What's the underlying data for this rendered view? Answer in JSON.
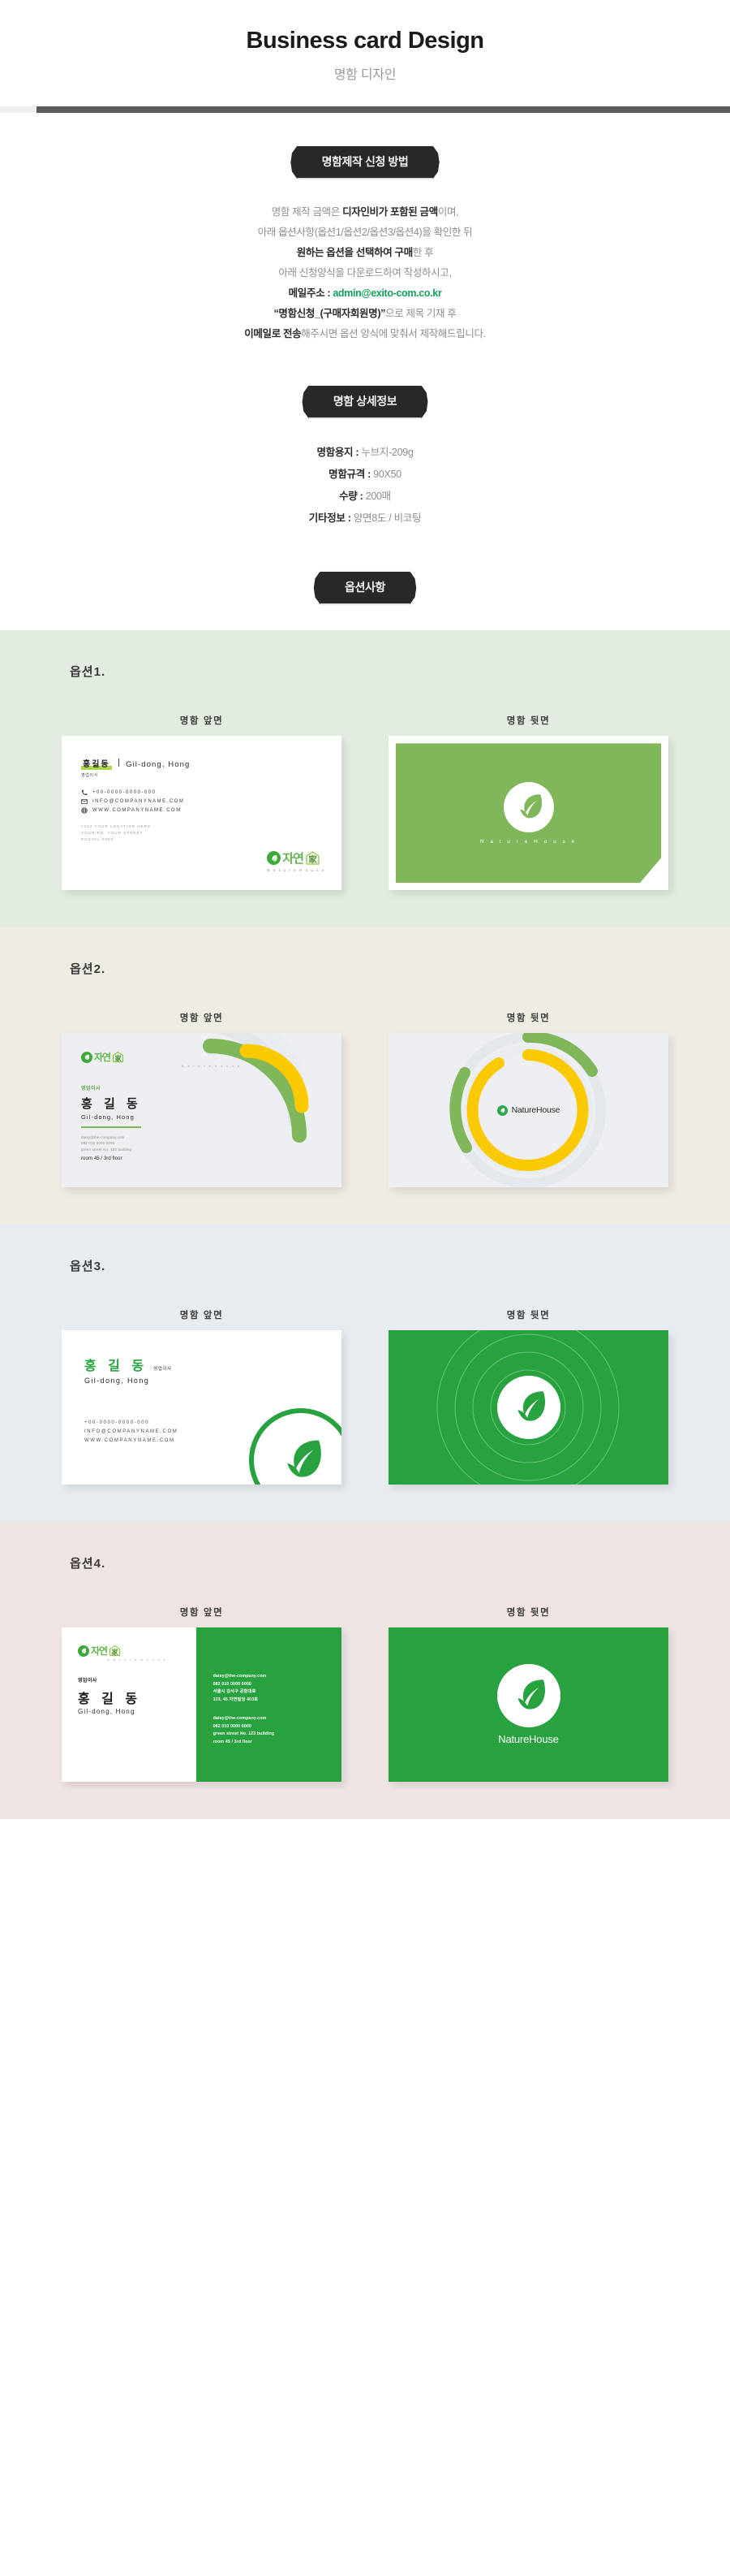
{
  "header": {
    "title": "Business card Design",
    "subtitle": "명함 디자인"
  },
  "how_to": {
    "badge": "명함제작 신청 방법",
    "lines": [
      {
        "pre": "명함 제작 금액은 ",
        "bold": "디자인비가 포함된 금액",
        "post": "이며,"
      },
      {
        "pre": "아래 옵션사항(옵션1/옵션2/옵션3/옵션4)을 확인한 뒤",
        "bold": "",
        "post": ""
      },
      {
        "pre": "",
        "bold": "원하는 옵션을 선택하여 구매",
        "post": "한 후"
      },
      {
        "pre": "아래 신청양식을 다운로드하여 작성하시고,",
        "bold": "",
        "post": ""
      }
    ],
    "mail_label": "메일주소 : ",
    "mail_address": "admin@exito-com.co.kr",
    "subject_bold": "“명함신청_(구매자회원명)”",
    "subject_post": "으로 제목 기재 후",
    "send_bold": "이메일로 전송",
    "send_post": "해주시면 옵션 양식에 맞춰서 제작해드립니다."
  },
  "spec": {
    "badge": "명함 상세정보",
    "rows": [
      {
        "label": "명함용지 : ",
        "value": "누브지-209g"
      },
      {
        "label": "명함규격 : ",
        "value": "90X50"
      },
      {
        "label": "수량 : ",
        "value": "200매"
      },
      {
        "label": "기타정보 : ",
        "value": "양면8도 / 비코팅"
      }
    ]
  },
  "options_badge": "옵션사항",
  "side_labels": {
    "front": "명함 앞면",
    "back": "명함 뒷면"
  },
  "brand": {
    "kr": "자연",
    "kr2": "家",
    "en": "NatureHouse",
    "en_spaced": "N a t u r e H o u s e",
    "en_spaced_small": "N a t u r e H o u s e"
  },
  "colors": {
    "accent_green": "#27a23f",
    "leaf_green": "#7fb75a",
    "logo_green": "#63b34e",
    "mail_green": "#13a05c",
    "yellow": "#fbc900",
    "badge_dark": "#282828",
    "bg_opt1": "#e3ece1",
    "bg_opt2": "#efece4",
    "bg_opt3": "#e6ecf0",
    "bg_opt4": "#eee5e3"
  },
  "options": [
    {
      "label": "옵션1.",
      "front": {
        "name_kr": "홍길동",
        "name_en": "Gil-dong, Hong",
        "role": "영업이사",
        "phone": "+00-0000-0000-000",
        "email": "INFO@COMPANYNAME.COM",
        "web": "WWW.COMPANYNAME.COM",
        "address": [
          "1234 YOUR LOCATION HERE",
          "YOUR RD. YOUR STREET",
          "POSTAL 8080"
        ]
      },
      "back": {
        "caption": "N a t u r e H o u s e"
      }
    },
    {
      "label": "옵션2.",
      "front": {
        "role": "영업이사",
        "name_kr": "홍 길 동",
        "name_en": "Gil-dong, Hong",
        "details": [
          "daisy@the-company.com",
          "082  010 0000 0000",
          "green street No. 123 building"
        ],
        "details_last": "room 45 / 3rd floor"
      },
      "back": {
        "logo_text": "NatureHouse"
      }
    },
    {
      "label": "옵션3.",
      "front": {
        "name_kr": "홍 길 동",
        "role": "영업이사",
        "name_en": "Gil-dong, Hong",
        "phone": "+00-0000-0000-000",
        "email": "INFO@COMPANYNAME.COM",
        "web": "WWW.COMPANYNAME.COM"
      },
      "back": {}
    },
    {
      "label": "옵션4.",
      "front": {
        "role": "영업이사",
        "name_kr": "홍 길 동",
        "name_en": "Gil-dong, Hong",
        "block1": [
          "daisy@the-company.com",
          "082  010 0000 0000",
          "서울시 강서구 공항대로",
          "123, 45 자연빌딩 403호"
        ],
        "block2": [
          "daisy@the-company.com",
          "082  010 0000 0000",
          "green street No. 123 building",
          "room 45 / 3rd floor"
        ]
      },
      "back": {
        "caption": "NatureHouse"
      }
    }
  ]
}
